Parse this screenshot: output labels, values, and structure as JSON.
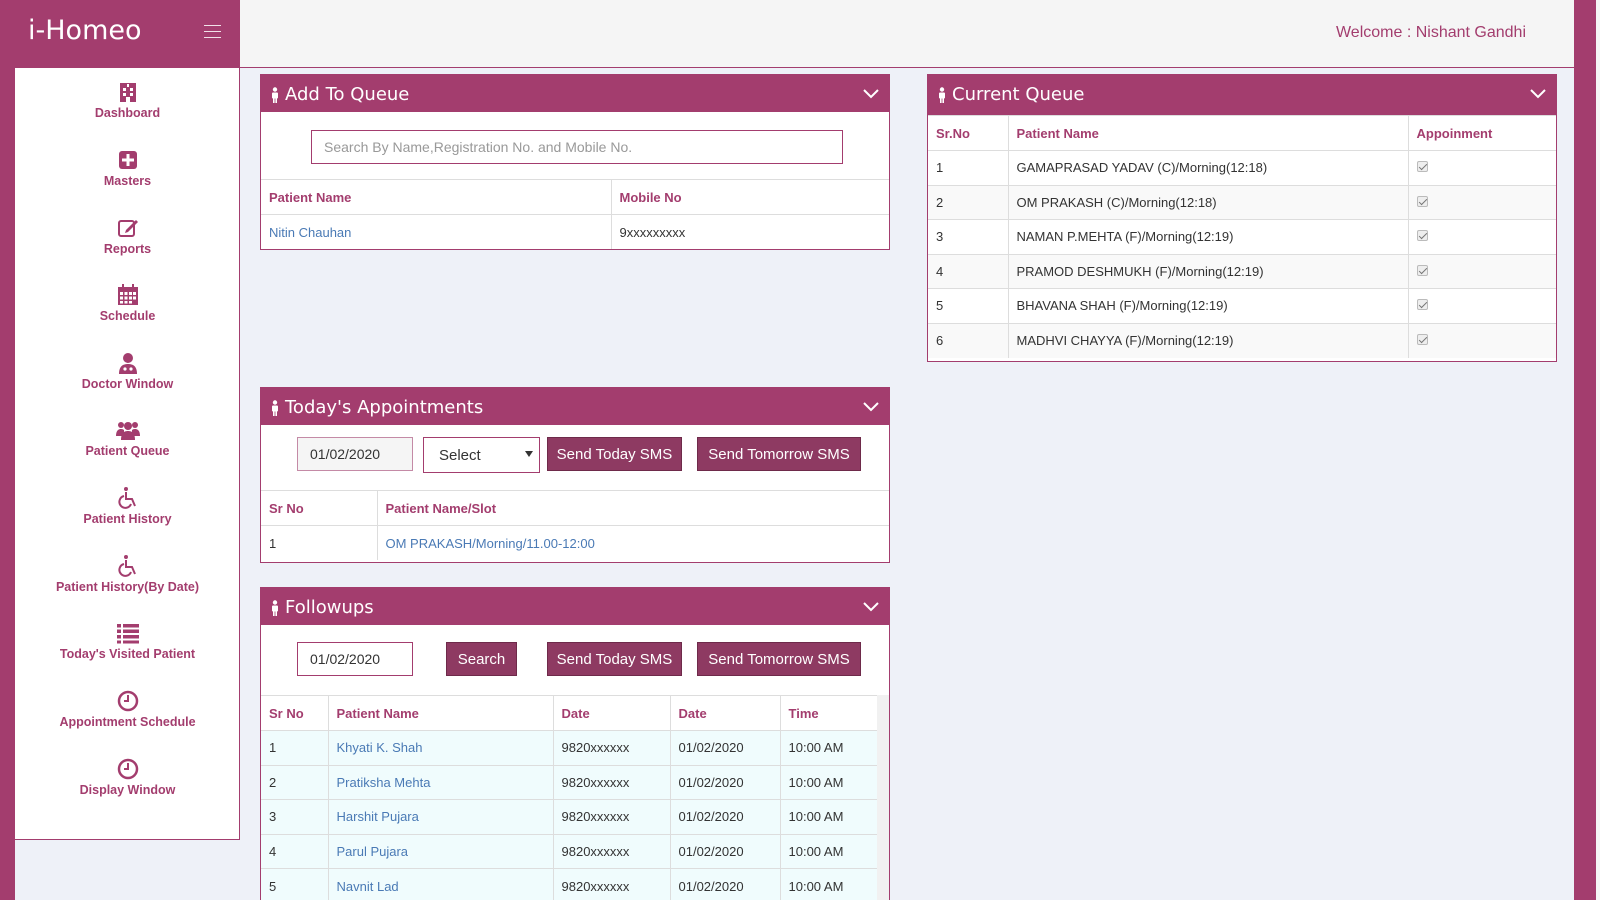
{
  "app": {
    "brand": "i-Homeo",
    "welcome": "Welcome : Nishant Gandhi"
  },
  "colors": {
    "primary": "#a33d6e",
    "button": "#8e3a62",
    "link": "#4a7ab5"
  },
  "sidebar": {
    "items": [
      {
        "label": "Dashboard",
        "icon": "hospital-icon"
      },
      {
        "label": "Masters",
        "icon": "plus-square-icon"
      },
      {
        "label": "Reports",
        "icon": "edit-icon"
      },
      {
        "label": "Schedule",
        "icon": "calendar-icon"
      },
      {
        "label": "Doctor Window",
        "icon": "user-md-icon"
      },
      {
        "label": "Patient Queue",
        "icon": "users-icon"
      },
      {
        "label": "Patient History",
        "icon": "wheelchair-icon"
      },
      {
        "label": "Patient History(By Date)",
        "icon": "wheelchair-icon"
      },
      {
        "label": "Today's Visited Patient",
        "icon": "list-icon"
      },
      {
        "label": "Appointment Schedule",
        "icon": "clock-icon"
      },
      {
        "label": "Display Window",
        "icon": "clock-icon"
      }
    ]
  },
  "add_to_queue": {
    "title": "Add To Queue",
    "search_placeholder": "Search By Name,Registration No. and  Mobile No.",
    "columns": [
      "Patient Name",
      "Mobile No"
    ],
    "rows": [
      {
        "name": "Nitin Chauhan",
        "mobile": "9xxxxxxxxx"
      }
    ]
  },
  "current_queue": {
    "title": "Current Queue",
    "columns": [
      "Sr.No",
      "Patient Name",
      "Appoinment"
    ],
    "rows": [
      {
        "no": "1",
        "name": "GAMAPRASAD YADAV (C)/Morning(12:18)",
        "checked": true
      },
      {
        "no": "2",
        "name": "OM PRAKASH (C)/Morning(12:18)",
        "checked": true
      },
      {
        "no": "3",
        "name": "NAMAN P.MEHTA (F)/Morning(12:19)",
        "checked": true
      },
      {
        "no": "4",
        "name": "PRAMOD DESHMUKH (F)/Morning(12:19)",
        "checked": true
      },
      {
        "no": "5",
        "name": "BHAVANA SHAH (F)/Morning(12:19)",
        "checked": true
      },
      {
        "no": "6",
        "name": "MADHVI CHAYYA (F)/Morning(12:19)",
        "checked": true
      }
    ]
  },
  "appointments": {
    "title": "Today's Appointments",
    "date": "01/02/2020",
    "select_value": "Select",
    "send_today": "Send Today SMS",
    "send_tomorrow": "Send Tomorrow SMS",
    "columns": [
      "Sr No",
      "Patient Name/Slot"
    ],
    "rows": [
      {
        "no": "1",
        "slot": "OM PRAKASH/Morning/11.00-12:00"
      }
    ]
  },
  "followups": {
    "title": "Followups",
    "date": "01/02/2020",
    "search": "Search",
    "send_today": "Send Today SMS",
    "send_tomorrow": "Send Tomorrow SMS",
    "columns": [
      "Sr No",
      "Patient Name",
      "Date",
      "Date",
      "Time"
    ],
    "rows": [
      {
        "no": "1",
        "name": "Khyati K. Shah",
        "mobile": "9820xxxxxx",
        "date": "01/02/2020",
        "time": "10:00 AM"
      },
      {
        "no": "2",
        "name": "Pratiksha Mehta",
        "mobile": "9820xxxxxx",
        "date": "01/02/2020",
        "time": "10:00 AM"
      },
      {
        "no": "3",
        "name": "Harshit Pujara",
        "mobile": "9820xxxxxx",
        "date": "01/02/2020",
        "time": "10:00 AM"
      },
      {
        "no": "4",
        "name": "Parul Pujara",
        "mobile": "9820xxxxxx",
        "date": "01/02/2020",
        "time": "10:00 AM"
      },
      {
        "no": "5",
        "name": "Navnit Lad",
        "mobile": "9820xxxxxx",
        "date": "01/02/2020",
        "time": "10:00 AM"
      }
    ]
  }
}
